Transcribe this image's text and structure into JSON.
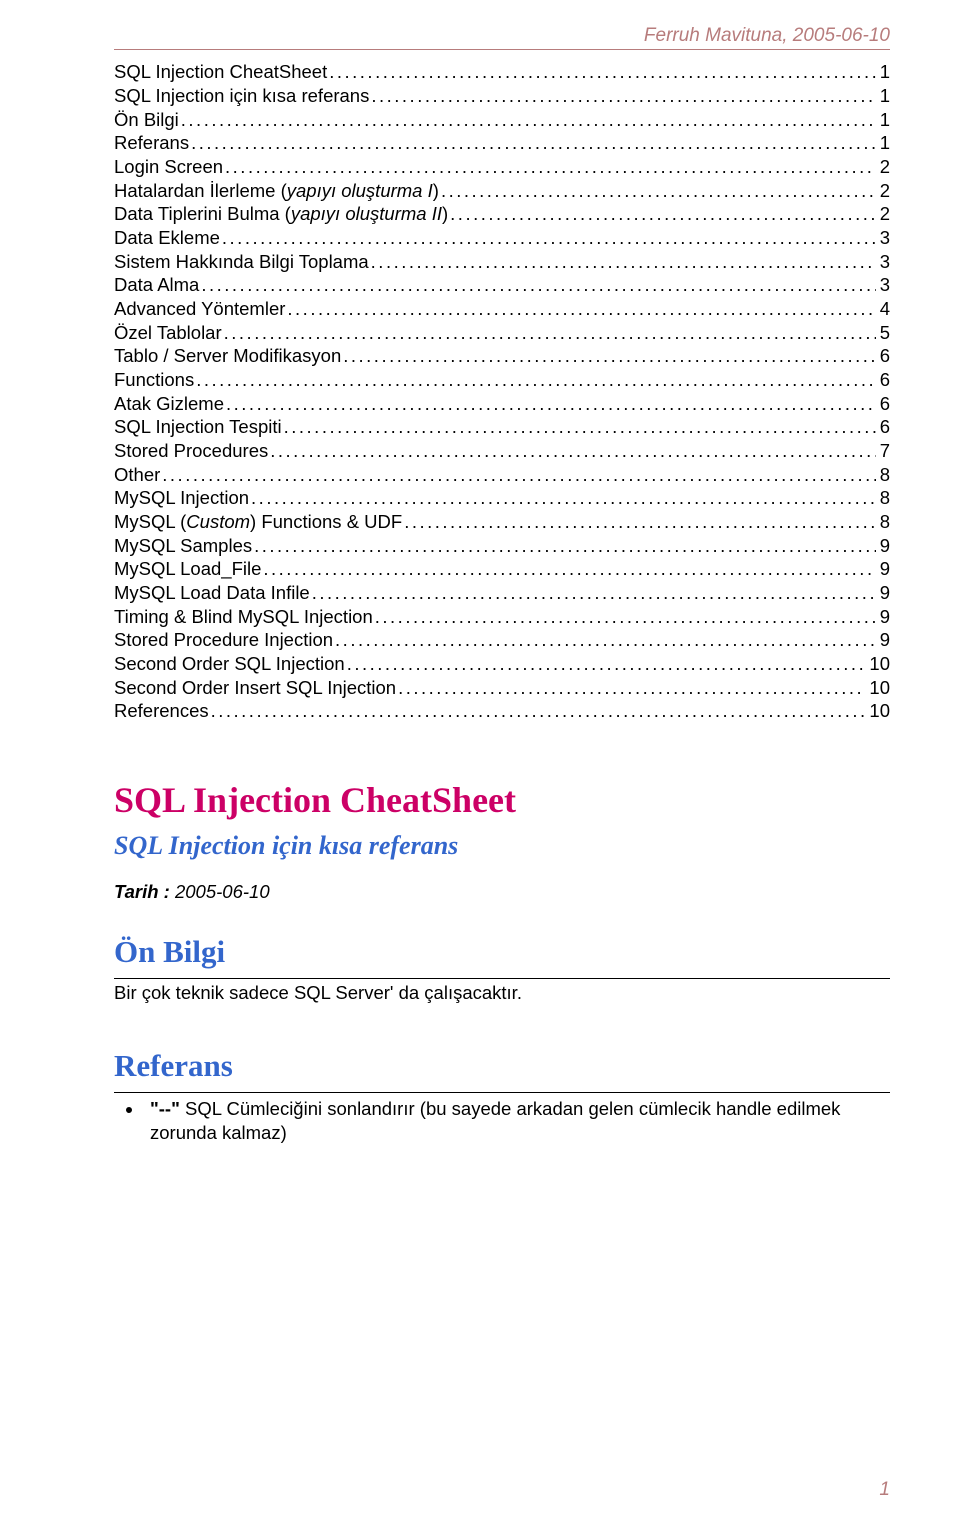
{
  "header": {
    "author": "Ferruh Mavituna, 2005-06-10"
  },
  "toc": [
    {
      "label_plain": "SQL Injection CheatSheet",
      "page": "1"
    },
    {
      "label_plain": "SQL Injection için kısa referans",
      "page": "1"
    },
    {
      "label_plain": "Ön Bilgi",
      "page": "1"
    },
    {
      "label_plain": "Referans",
      "page": "1"
    },
    {
      "label_plain": "Login Screen",
      "page": "2"
    },
    {
      "label_pre": "Hatalardan İlerleme (",
      "label_emph": "yapıyı oluşturma I",
      "label_post": ")",
      "page": "2"
    },
    {
      "label_pre": "Data Tiplerini Bulma (",
      "label_emph": "yapıyı oluşturma II",
      "label_post": ")",
      "page": "2"
    },
    {
      "label_plain": "Data Ekleme",
      "page": "3"
    },
    {
      "label_plain": "Sistem Hakkında Bilgi Toplama",
      "page": "3"
    },
    {
      "label_plain": "Data Alma",
      "page": "3"
    },
    {
      "label_plain": "Advanced Yöntemler",
      "page": "4"
    },
    {
      "label_plain": "Özel Tablolar",
      "page": "5"
    },
    {
      "label_plain": "Tablo / Server  Modifikasyon",
      "page": "6"
    },
    {
      "label_plain": "Functions",
      "page": "6"
    },
    {
      "label_plain": "Atak Gizleme",
      "page": "6"
    },
    {
      "label_plain": "SQL Injection Tespiti",
      "page": "6"
    },
    {
      "label_plain": "Stored Procedures",
      "page": "7"
    },
    {
      "label_plain": "Other",
      "page": "8"
    },
    {
      "label_plain": "MySQL Injection",
      "page": "8"
    },
    {
      "label_pre": "MySQL (",
      "label_emph": "Custom",
      "label_post": ") Functions & UDF",
      "page": "8"
    },
    {
      "label_plain": "MySQL Samples",
      "page": "9"
    },
    {
      "label_plain": "MySQL Load_File",
      "page": "9"
    },
    {
      "label_plain": "MySQL Load Data Infile",
      "page": "9"
    },
    {
      "label_plain": "Timing & Blind MySQL Injection",
      "page": "9"
    },
    {
      "label_plain": "Stored Procedure Injection",
      "page": "9"
    },
    {
      "label_plain": "Second Order SQL Injection",
      "page": "10"
    },
    {
      "label_plain": "Second Order Insert SQL Injection",
      "page": "10"
    },
    {
      "label_plain": "References",
      "page": "10"
    }
  ],
  "titles": {
    "h1": "SQL Injection CheatSheet",
    "h2": "SQL Injection için kısa referans",
    "tarih_label": "Tarih :",
    "tarih_value": " 2005-06-10",
    "onbilgi": "Ön Bilgi",
    "onbilgi_body": "Bir çok teknik sadece SQL Server' da çalışacaktır.",
    "referans": "Referans",
    "ref_item_quote": "\"--\"",
    "ref_item_rest": "    SQL Cümleciğini sonlandırır (bu sayede arkadan gelen cümlecik handle edilmek zorunda kalmaz)"
  },
  "page_number": "1"
}
